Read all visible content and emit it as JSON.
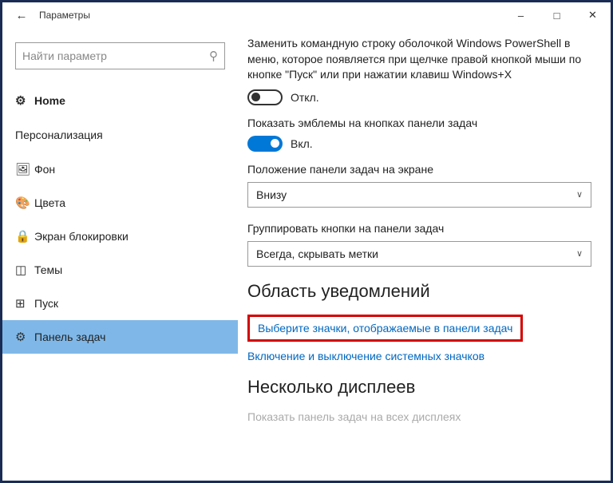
{
  "titlebar": {
    "title": "Параметры"
  },
  "search": {
    "placeholder": "Найти параметр"
  },
  "sidebar": {
    "home": "Home",
    "group": "Персонализация",
    "items": [
      {
        "label": "Фон"
      },
      {
        "label": "Цвета"
      },
      {
        "label": "Экран блокировки"
      },
      {
        "label": "Темы"
      },
      {
        "label": "Пуск"
      },
      {
        "label": "Панель задач"
      }
    ]
  },
  "main": {
    "powershell_desc": "Заменить командную строку оболочкой Windows PowerShell в меню, которое появляется при щелчке правой кнопкой мыши по кнопке \"Пуск\" или при нажатии клавиш Windows+X",
    "off_label": "Откл.",
    "badges_label": "Показать эмблемы на кнопках панели задач",
    "on_label": "Вкл.",
    "position_label": "Положение панели задач на экране",
    "position_value": "Внизу",
    "group_label": "Группировать кнопки на панели задач",
    "group_value": "Всегда, скрывать метки",
    "notif_section": "Область уведомлений",
    "link1": "Выберите значки, отображаемые в панели задач",
    "link2": "Включение и выключение системных значков",
    "displays_section": "Несколько дисплеев",
    "displays_desc": "Показать панель задач на всех дисплеях"
  }
}
